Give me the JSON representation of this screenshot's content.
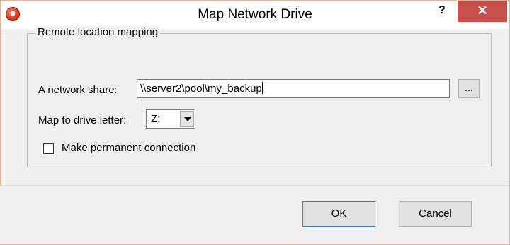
{
  "window": {
    "title": "Map Network Drive",
    "help_label": "?",
    "close_label": "✕"
  },
  "group": {
    "label": "Remote location mapping"
  },
  "share": {
    "label": "A network share:",
    "value": "\\\\server2\\pool\\my_backup",
    "browse_label": "..."
  },
  "drive": {
    "label": "Map to drive letter:",
    "selected": "Z:"
  },
  "permanent": {
    "label": "Make permanent connection",
    "checked": false
  },
  "buttons": {
    "ok": "OK",
    "cancel": "Cancel"
  },
  "colors": {
    "close_button": "#c7504d",
    "window_border": "#e3b49a",
    "ok_border": "#3c7fb1"
  }
}
